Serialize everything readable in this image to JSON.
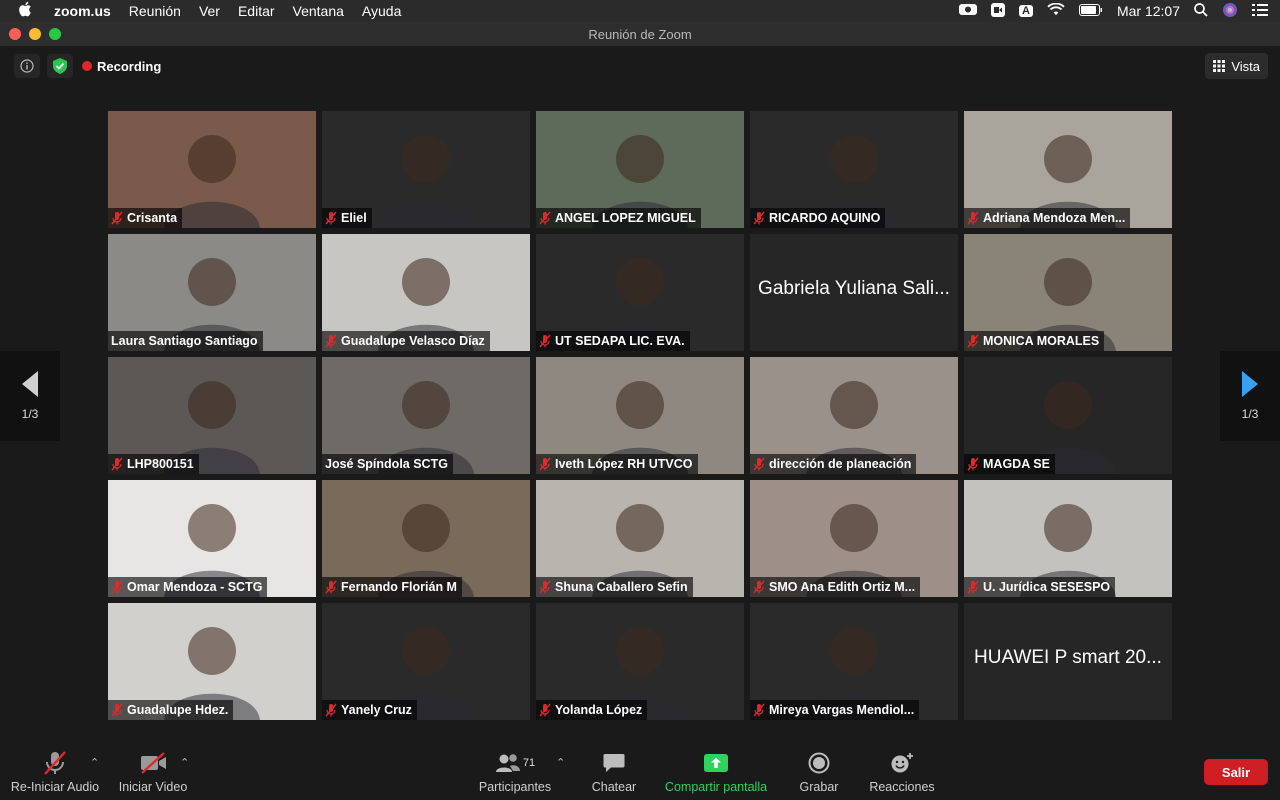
{
  "menubar": {
    "app_name": "zoom.us",
    "items": [
      "Reunión",
      "Ver",
      "Editar",
      "Ventana",
      "Ayuda"
    ],
    "clock": "Mar 12:07",
    "input_source": "A"
  },
  "window": {
    "title": "Reunión de Zoom",
    "recording_label": "Recording",
    "view_label": "Vista"
  },
  "pager": {
    "left_label": "1/3",
    "right_label": "1/3"
  },
  "participants": [
    {
      "name": "Crisanta",
      "bg": "#7a5a4a",
      "muted": true
    },
    {
      "name": "Eliel",
      "bg": "#2a2a2a",
      "muted": true
    },
    {
      "name": "ANGEL LOPEZ MIGUEL",
      "bg": "#5e6a5a",
      "muted": true
    },
    {
      "name": "RICARDO AQUINO",
      "bg": "#2a2a2a",
      "muted": true
    },
    {
      "name": "Adriana Mendoza Men...",
      "bg": "#a9a49c",
      "muted": true
    },
    {
      "name": "Laura Santiago Santiago",
      "bg": "#8c8a86",
      "muted": false
    },
    {
      "name": "Guadalupe Velasco Díaz",
      "bg": "#c8c6c2",
      "muted": true
    },
    {
      "name": "UT SEDAPA LIC. EVA.",
      "bg": "#2a2a2a",
      "muted": true
    },
    {
      "name": "Gabriela Yuliana Sali...",
      "bg": "#262626",
      "muted": false,
      "text_only": true
    },
    {
      "name": "MONICA MORALES",
      "bg": "#8a8478",
      "muted": true
    },
    {
      "name": "LHP800151",
      "bg": "#5c5856",
      "muted": true
    },
    {
      "name": "José Spíndola SCTG",
      "bg": "#6e6a66",
      "muted": false,
      "active": true
    },
    {
      "name": "Iveth López RH UTVCO",
      "bg": "#8e8880",
      "muted": true
    },
    {
      "name": "dirección de planeación",
      "bg": "#9a918a",
      "muted": true
    },
    {
      "name": "MAGDA SE",
      "bg": "#262626",
      "muted": true
    },
    {
      "name": "Omar Mendoza - SCTG",
      "bg": "#e8e6e4",
      "muted": true
    },
    {
      "name": "Fernando Florián M",
      "bg": "#7a6a5a",
      "muted": true
    },
    {
      "name": "Shuna Caballero Sefin",
      "bg": "#b8b4ae",
      "muted": true
    },
    {
      "name": "SMO Ana Edith Ortiz M...",
      "bg": "#9c9088",
      "muted": true
    },
    {
      "name": "U. Jurídica SESESPO",
      "bg": "#c4c2be",
      "muted": true
    },
    {
      "name": "Guadalupe Hdez.",
      "bg": "#d2d0cc",
      "muted": true
    },
    {
      "name": "Yanely Cruz",
      "bg": "#2a2a2a",
      "muted": true
    },
    {
      "name": "Yolanda López",
      "bg": "#2a2a2a",
      "muted": true
    },
    {
      "name": "Mireya Vargas Mendiol...",
      "bg": "#2a2a2a",
      "muted": true
    },
    {
      "name": "HUAWEI P smart 20...",
      "bg": "#262626",
      "muted": false,
      "text_only": true,
      "no_bar": true
    }
  ],
  "toolbar": {
    "audio_label": "Re-Iniciar Audio",
    "video_label": "Iniciar Video",
    "participants_label": "Participantes",
    "participants_count": "71",
    "chat_label": "Chatear",
    "share_label": "Compartir pantalla",
    "record_label": "Grabar",
    "reactions_label": "Reacciones",
    "leave_label": "Salir"
  },
  "colors": {
    "share_green": "#2dd35a",
    "leave_red": "#cf1f24",
    "active_speaker": "#d8e07a",
    "mute_red": "#e0282d"
  }
}
